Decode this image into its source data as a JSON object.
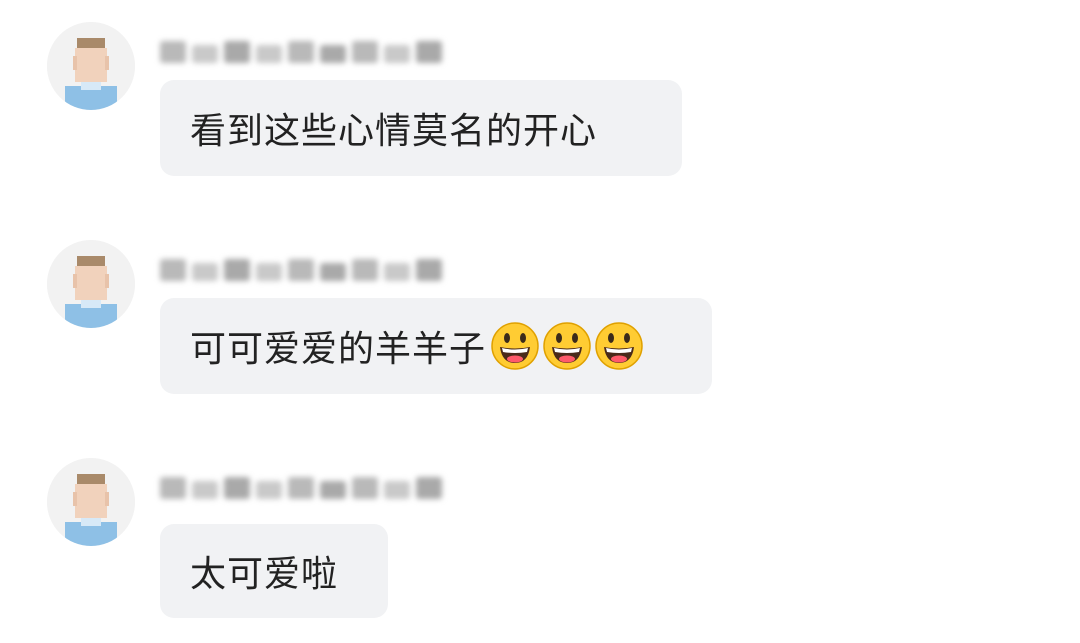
{
  "messages": [
    {
      "avatar_icon": "user-avatar-icon",
      "nickname_blurred": true,
      "text": "看到这些心情莫名的开心",
      "emojis": []
    },
    {
      "avatar_icon": "user-avatar-icon",
      "nickname_blurred": true,
      "text": "可可爱爱的羊羊子",
      "emojis": [
        "grinning-face-icon",
        "grinning-face-icon",
        "grinning-face-icon"
      ]
    },
    {
      "avatar_icon": "user-avatar-icon",
      "nickname_blurred": true,
      "text": "太可爱啦",
      "emojis": []
    }
  ],
  "colors": {
    "bubble_background": "#f1f2f4",
    "text": "#222222",
    "emoji_face": "#ffcc33"
  }
}
